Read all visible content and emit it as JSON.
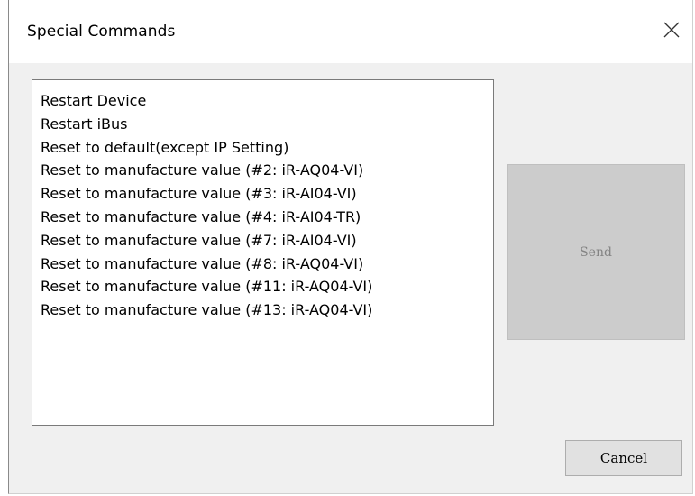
{
  "dialog": {
    "title": "Special Commands",
    "close_icon": "close-icon"
  },
  "commands": [
    "Restart Device",
    "Restart iBus",
    "Reset to default(except IP Setting)",
    "Reset to manufacture value (#2: iR-AQ04-VI)",
    "Reset to manufacture value (#3: iR-AI04-VI)",
    "Reset to manufacture value (#4: iR-AI04-TR)",
    "Reset to manufacture value (#7: iR-AI04-VI)",
    "Reset to manufacture value (#8: iR-AQ04-VI)",
    "Reset to manufacture value (#11: iR-AQ04-VI)",
    "Reset to manufacture value (#13: iR-AQ04-VI)"
  ],
  "buttons": {
    "send_label": "Send",
    "send_enabled": false,
    "cancel_label": "Cancel"
  },
  "colors": {
    "window_bg": "#f0f0f0",
    "titlebar_bg": "#ffffff",
    "disabled_button_bg": "#cccccc",
    "disabled_text": "#838383"
  }
}
